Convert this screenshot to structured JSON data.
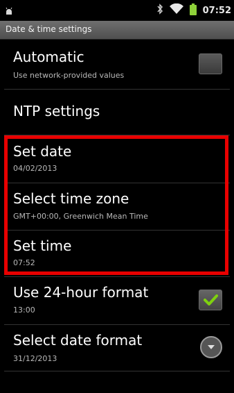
{
  "status_bar": {
    "time": "07:52",
    "icons": [
      "android-debug-icon",
      "bluetooth-icon",
      "wifi-icon",
      "battery-icon"
    ]
  },
  "title_bar": {
    "title": "Date & time settings"
  },
  "settings": {
    "automatic": {
      "title": "Automatic",
      "summary": "Use network-provided values",
      "checked": false
    },
    "ntp": {
      "title": "NTP settings"
    },
    "set_date": {
      "title": "Set date",
      "summary": "04/02/2013"
    },
    "time_zone": {
      "title": "Select time zone",
      "summary": "GMT+00:00, Greenwich Mean Time"
    },
    "set_time": {
      "title": "Set time",
      "summary": "07:52"
    },
    "hour_24": {
      "title": "Use 24-hour format",
      "summary": "13:00",
      "checked": true
    },
    "date_format": {
      "title": "Select date format",
      "summary": "31/12/2013"
    }
  },
  "colors": {
    "highlight": "#e80000",
    "check": "#7fd10f",
    "battery": "#8fd13a"
  }
}
